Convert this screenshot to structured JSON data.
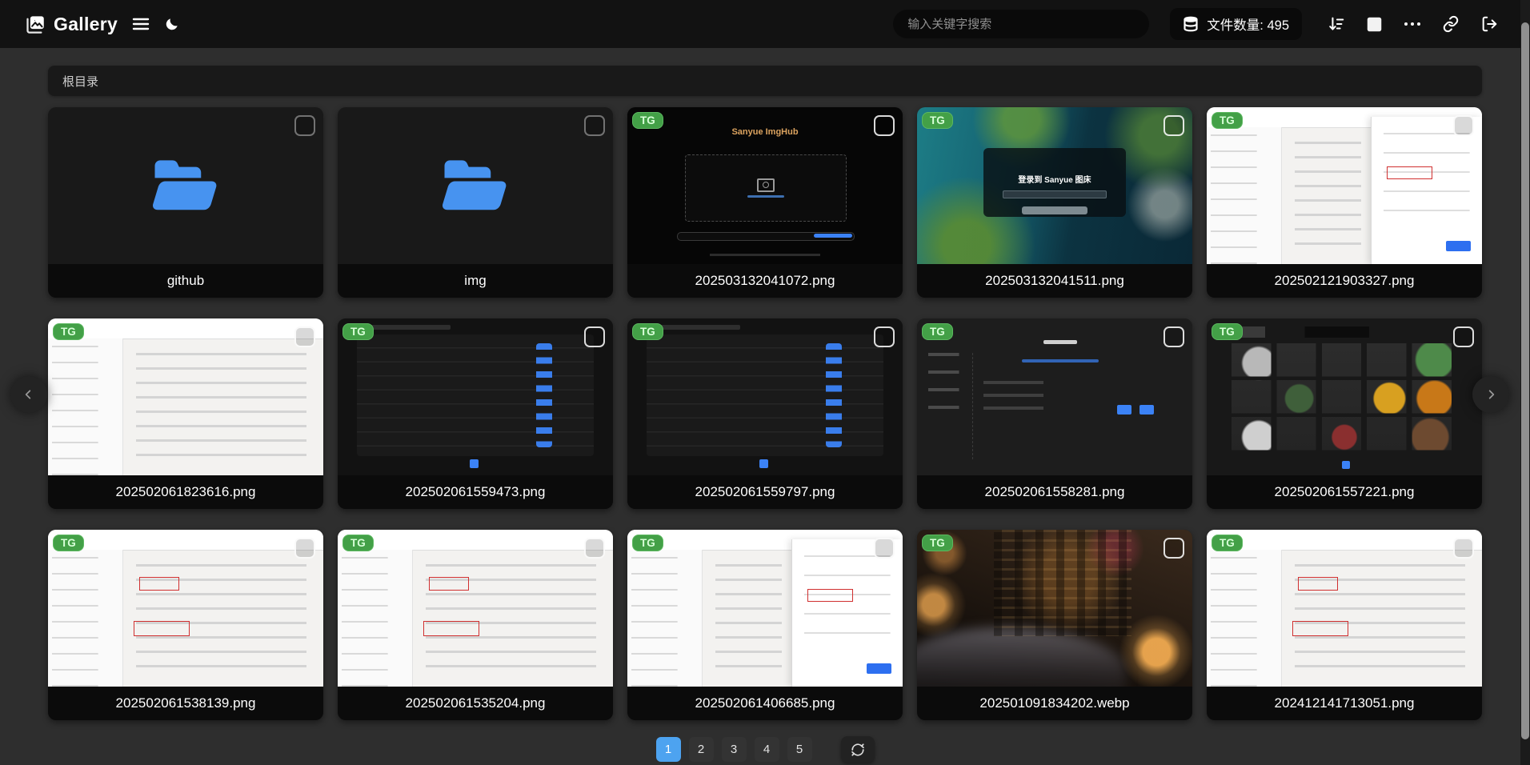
{
  "nav": {
    "title": "Gallery",
    "search_placeholder": "输入关键字搜索",
    "file_count_label": "文件数量: 495",
    "icons": [
      "gallery-logo",
      "hamburger-menu",
      "moon",
      "database",
      "sort-descending",
      "square-select",
      "ellipsis",
      "link",
      "logout"
    ]
  },
  "breadcrumb": {
    "path": "根目录"
  },
  "grid": {
    "items": [
      {
        "type": "folder",
        "label": "github"
      },
      {
        "type": "folder",
        "label": "img"
      },
      {
        "type": "image",
        "label": "202503132041072.png",
        "badge": "TG",
        "thumb": "upload-dark",
        "thumb_text": "Sanyue ImgHub"
      },
      {
        "type": "image",
        "label": "202503132041511.png",
        "badge": "TG",
        "thumb": "ocean-login",
        "thumb_text": "登录到 Sanyue 图床"
      },
      {
        "type": "image",
        "label": "202502121903327.png",
        "badge": "TG",
        "thumb": "cf-light-panel"
      },
      {
        "type": "image",
        "label": "202502061823616.png",
        "badge": "TG",
        "thumb": "cf-light"
      },
      {
        "type": "image",
        "label": "202502061559473.png",
        "badge": "TG",
        "thumb": "dark-table"
      },
      {
        "type": "image",
        "label": "202502061559797.png",
        "badge": "TG",
        "thumb": "dark-table"
      },
      {
        "type": "image",
        "label": "202502061558281.png",
        "badge": "TG",
        "thumb": "dark-settings"
      },
      {
        "type": "image",
        "label": "202502061557221.png",
        "badge": "TG",
        "thumb": "gallery-grid"
      },
      {
        "type": "image",
        "label": "202502061538139.png",
        "badge": "TG",
        "thumb": "cf-light-annotated"
      },
      {
        "type": "image",
        "label": "202502061535204.png",
        "badge": "TG",
        "thumb": "cf-light-annotated"
      },
      {
        "type": "image",
        "label": "202502061406685.png",
        "badge": "TG",
        "thumb": "cf-light-panel"
      },
      {
        "type": "image",
        "label": "202501091834202.webp",
        "badge": "TG",
        "thumb": "anime-night"
      },
      {
        "type": "image",
        "label": "202412141713051.png",
        "badge": "TG",
        "thumb": "cf-light-annotated"
      }
    ]
  },
  "pagination": {
    "pages": [
      "1",
      "2",
      "3",
      "4",
      "5"
    ],
    "active": "1"
  },
  "colors": {
    "accent": "#4da3f0",
    "folder_blue": "#4793f0",
    "badge_green": "#43a047",
    "topbar": "#121212",
    "page_bg": "#2e2e2e"
  }
}
